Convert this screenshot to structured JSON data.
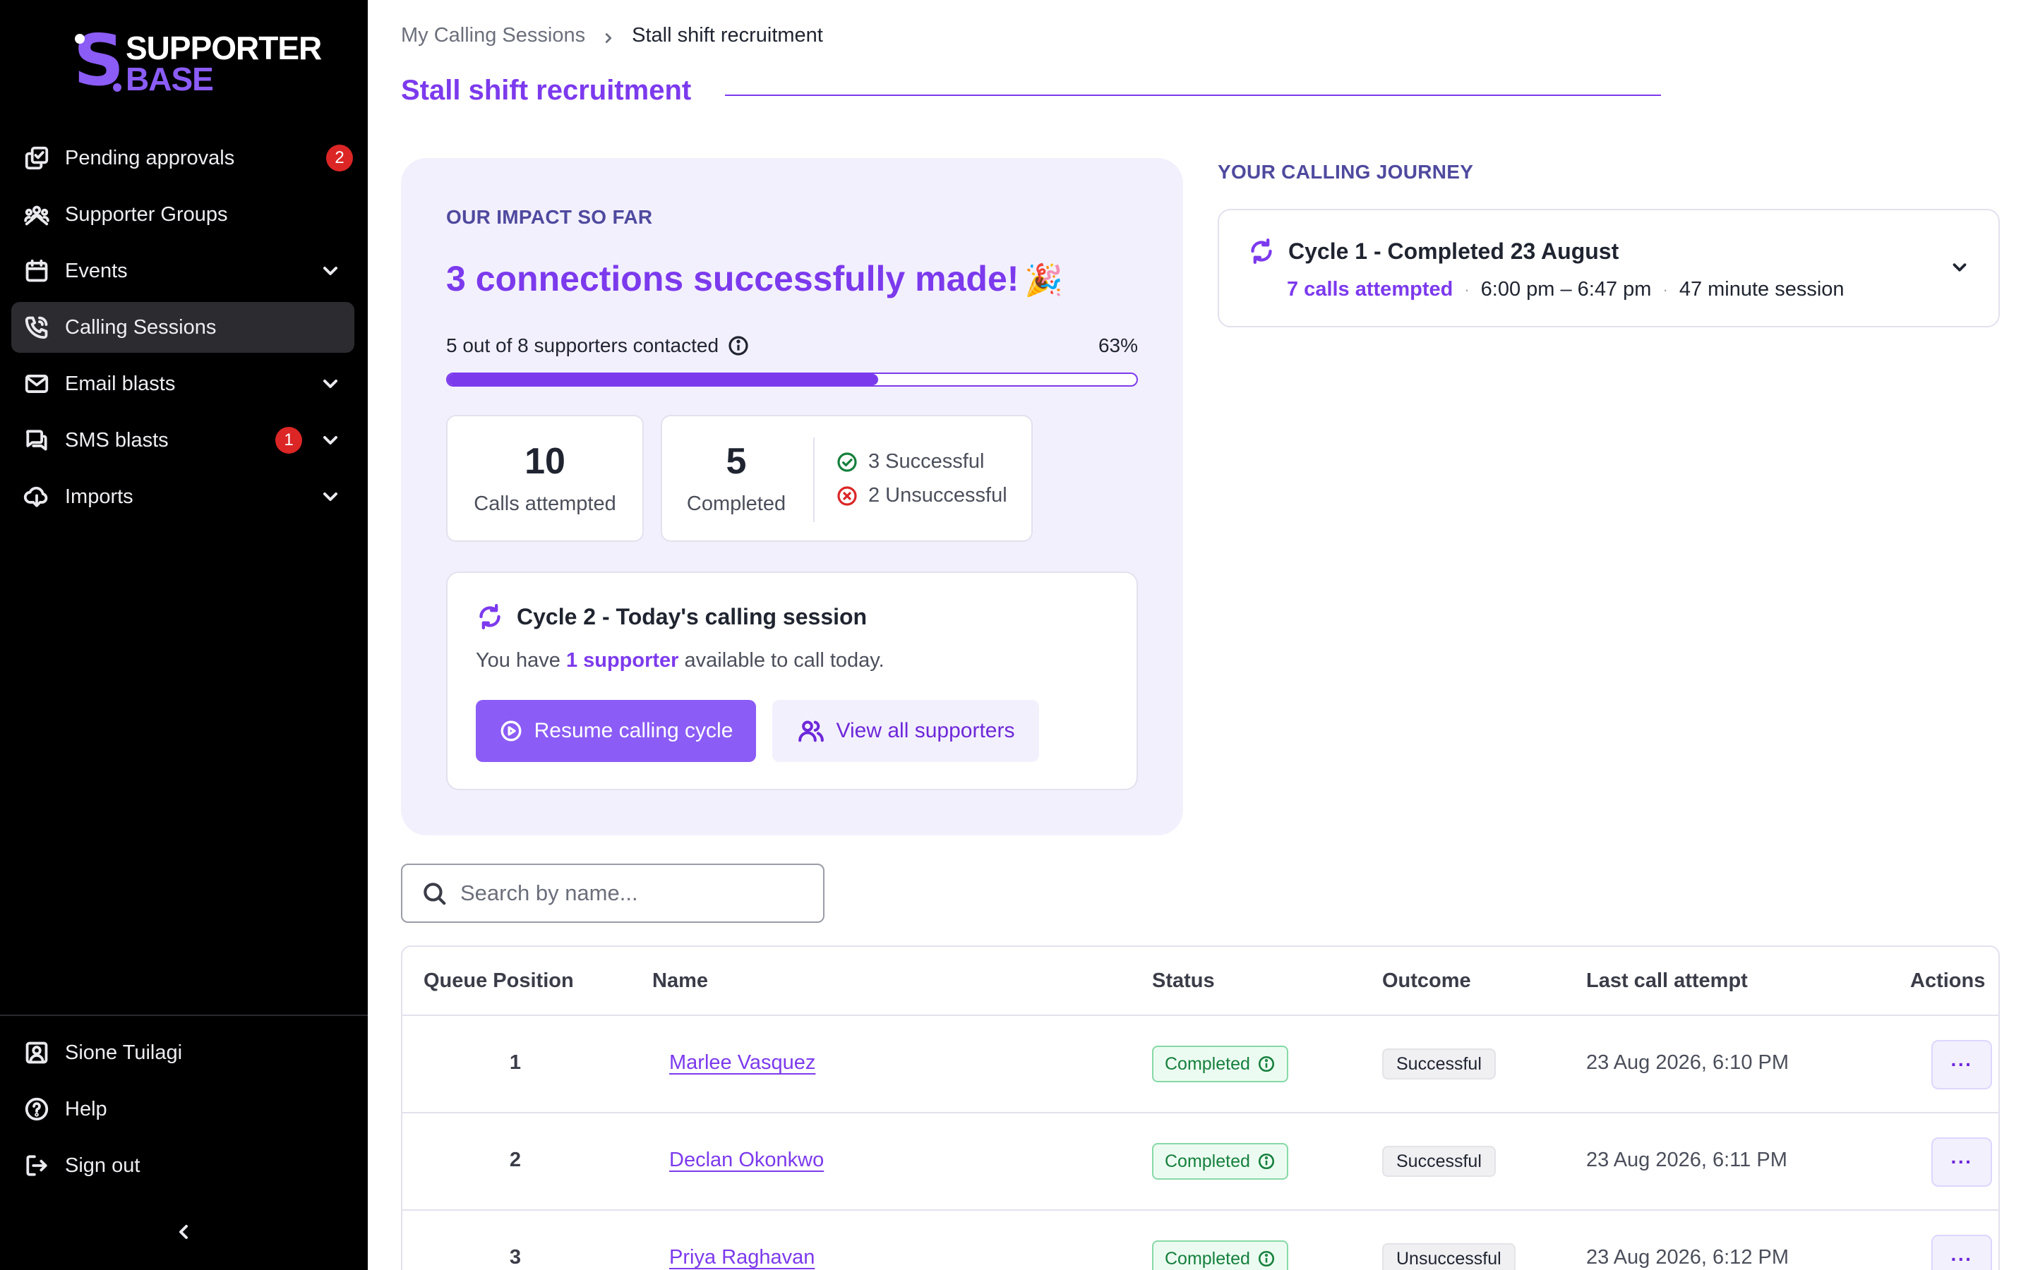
{
  "brand": {
    "logo_top": "SUPPORTER",
    "logo_bottom": "BASE",
    "logo_letter": "S",
    "accent": "#7c3aed"
  },
  "sidebar": {
    "items": [
      {
        "label": "Pending approvals",
        "icon": "approvals-icon",
        "badge": "2"
      },
      {
        "label": "Supporter Groups",
        "icon": "groups-icon"
      },
      {
        "label": "Events",
        "icon": "calendar-icon",
        "expandable": true
      },
      {
        "label": "Calling Sessions",
        "icon": "phone-icon",
        "active": true
      },
      {
        "label": "Email blasts",
        "icon": "mail-icon",
        "expandable": true
      },
      {
        "label": "SMS blasts",
        "icon": "chat-icon",
        "badge": "1",
        "expandable": true
      },
      {
        "label": "Imports",
        "icon": "import-icon",
        "expandable": true
      }
    ],
    "bottom": [
      {
        "label": "Sione Tuilagi",
        "icon": "user-icon"
      },
      {
        "label": "Help",
        "icon": "help-icon"
      },
      {
        "label": "Sign out",
        "icon": "sign-out-icon"
      }
    ]
  },
  "breadcrumb": {
    "parent": "My Calling Sessions",
    "current": "Stall shift recruitment"
  },
  "page": {
    "title": "Stall shift recruitment"
  },
  "impact": {
    "eyebrow": "OUR IMPACT SO FAR",
    "headline": "3 connections successfully made!",
    "headline_emoji": "🎉",
    "progress_label": "5 out of 8 supporters contacted",
    "progress_pct_text": "63%",
    "progress_fraction": 0.625,
    "calls_attempted_value": "10",
    "calls_attempted_label": "Calls attempted",
    "completed_value": "5",
    "completed_label": "Completed",
    "successful_label": "3 Successful",
    "unsuccessful_label": "2 Unsuccessful"
  },
  "cycle": {
    "title": "Cycle 2 - Today's calling session",
    "text_before": "You have ",
    "text_highlight": "1 supporter",
    "text_after": " available to call today.",
    "resume_label": "Resume calling cycle",
    "view_label": "View all supporters"
  },
  "journey": {
    "eyebrow": "YOUR CALLING JOURNEY",
    "cycle_title": "Cycle 1 - Completed 23 August",
    "calls": "7 calls attempted",
    "time": "6:00 pm – 6:47 pm",
    "duration": "47 minute session",
    "separator": "·"
  },
  "search": {
    "placeholder": "Search by name..."
  },
  "table": {
    "headers": {
      "position": "Queue Position",
      "name": "Name",
      "status": "Status",
      "outcome": "Outcome",
      "last_call": "Last call attempt",
      "actions": "Actions"
    },
    "rows": [
      {
        "position": "1",
        "name": "Marlee Vasquez",
        "status": "Completed",
        "outcome": "Successful",
        "last_call": "23 Aug 2026, 6:10 PM",
        "actions": "···"
      },
      {
        "position": "2",
        "name": "Declan Okonkwo",
        "status": "Completed",
        "outcome": "Successful",
        "last_call": "23 Aug 2026, 6:11 PM",
        "actions": "···"
      },
      {
        "position": "3",
        "name": "Priya Raghavan",
        "status": "Completed",
        "outcome": "Unsuccessful",
        "last_call": "23 Aug 2026, 6:12 PM",
        "actions": "···"
      }
    ]
  }
}
